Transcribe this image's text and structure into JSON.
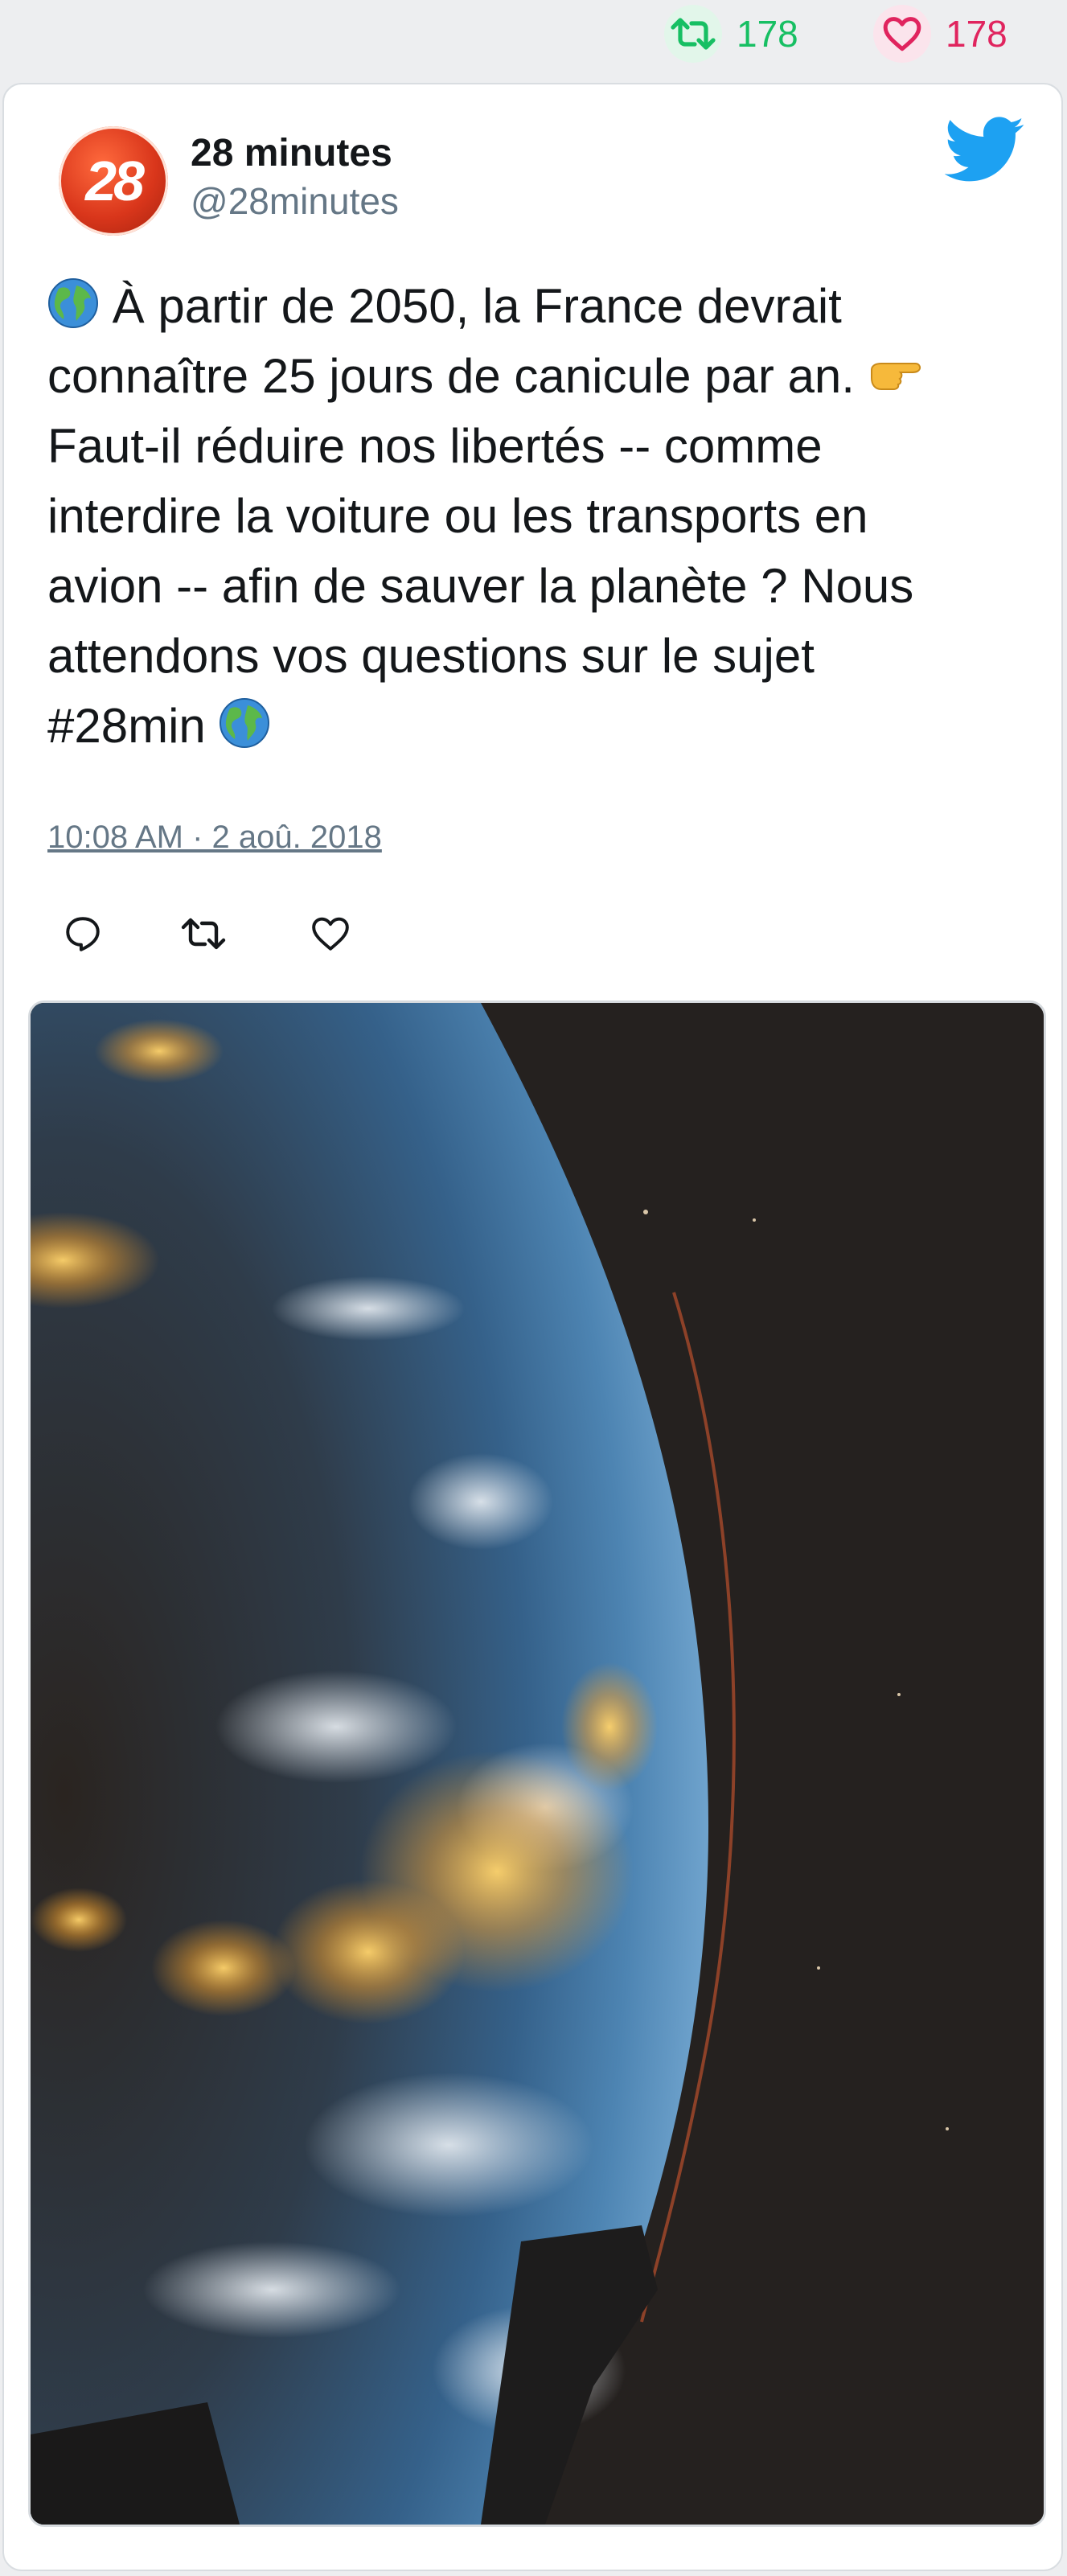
{
  "stats": {
    "retweets": "178",
    "likes": "178",
    "retweet_icon": "retweet-icon",
    "like_icon": "heart-icon",
    "retweet_color": "#17bf63",
    "like_color": "#e0245e"
  },
  "tweet": {
    "author": {
      "avatar_text": "28",
      "name": "28 minutes",
      "handle": "@28minutes"
    },
    "text_lines": [
      "À partir de 2050, la France devrait",
      "connaître 25 jours de canicule par an.",
      "Faut-il réduire nos libertés -- comme",
      "interdire la voiture ou les transports en",
      "avion -- afin de sauver la planète ? Nous",
      "attendons vos questions sur le sujet",
      "#28min"
    ],
    "timestamp": "10:08 AM · 2 aoû. 2018",
    "actions": [
      "reply-icon",
      "retweet-icon",
      "heart-icon"
    ],
    "brand_color": "#1da1f2"
  },
  "media": {
    "kind": "photo",
    "subject": "earth-at-night-from-orbit"
  }
}
